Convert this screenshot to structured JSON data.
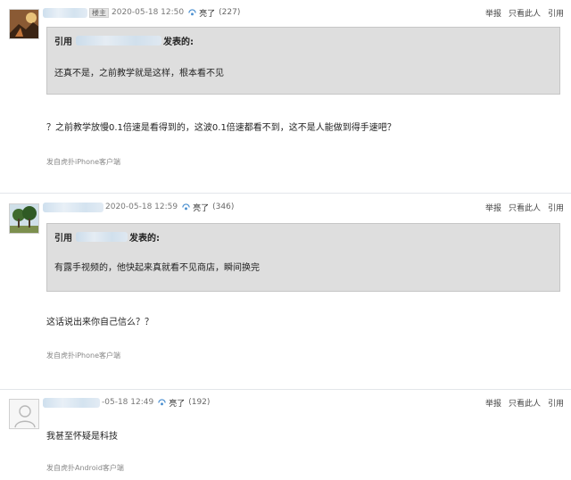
{
  "posts": [
    {
      "badge": "楼主",
      "time": "2020-05-18 12:50",
      "light_label": "亮了",
      "light_count": "(227)",
      "actions": [
        "举报",
        "只看此人",
        "引用"
      ],
      "quote_prefix": "引用",
      "quote_suffix": "发表的:",
      "quote_body": "还真不是，之前教学就是这样，根本看不见",
      "content": "？之前教学放慢0.1倍速是看得到的，这波0.1倍速都看不到，这不是人能做到得手速吧？",
      "source": "发自虎扑iPhone客户端"
    },
    {
      "time": "2020-05-18 12:59",
      "light_label": "亮了",
      "light_count": "(346)",
      "actions": [
        "举报",
        "只看此人",
        "引用"
      ],
      "quote_prefix": "引用",
      "quote_suffix": "发表的:",
      "quote_body": "有露手视频的，他快起来真就看不见商店，瞬间换完",
      "content": "这话说出来你自己信么？？",
      "source": "发自虎扑iPhone客户端"
    },
    {
      "time": "-05-18 12:49",
      "light_label": "亮了",
      "light_count": "(192)",
      "actions": [
        "举报",
        "只看此人",
        "引用"
      ],
      "content": "我甚至怀疑是科技",
      "source": "发自虎扑Android客户端"
    }
  ]
}
